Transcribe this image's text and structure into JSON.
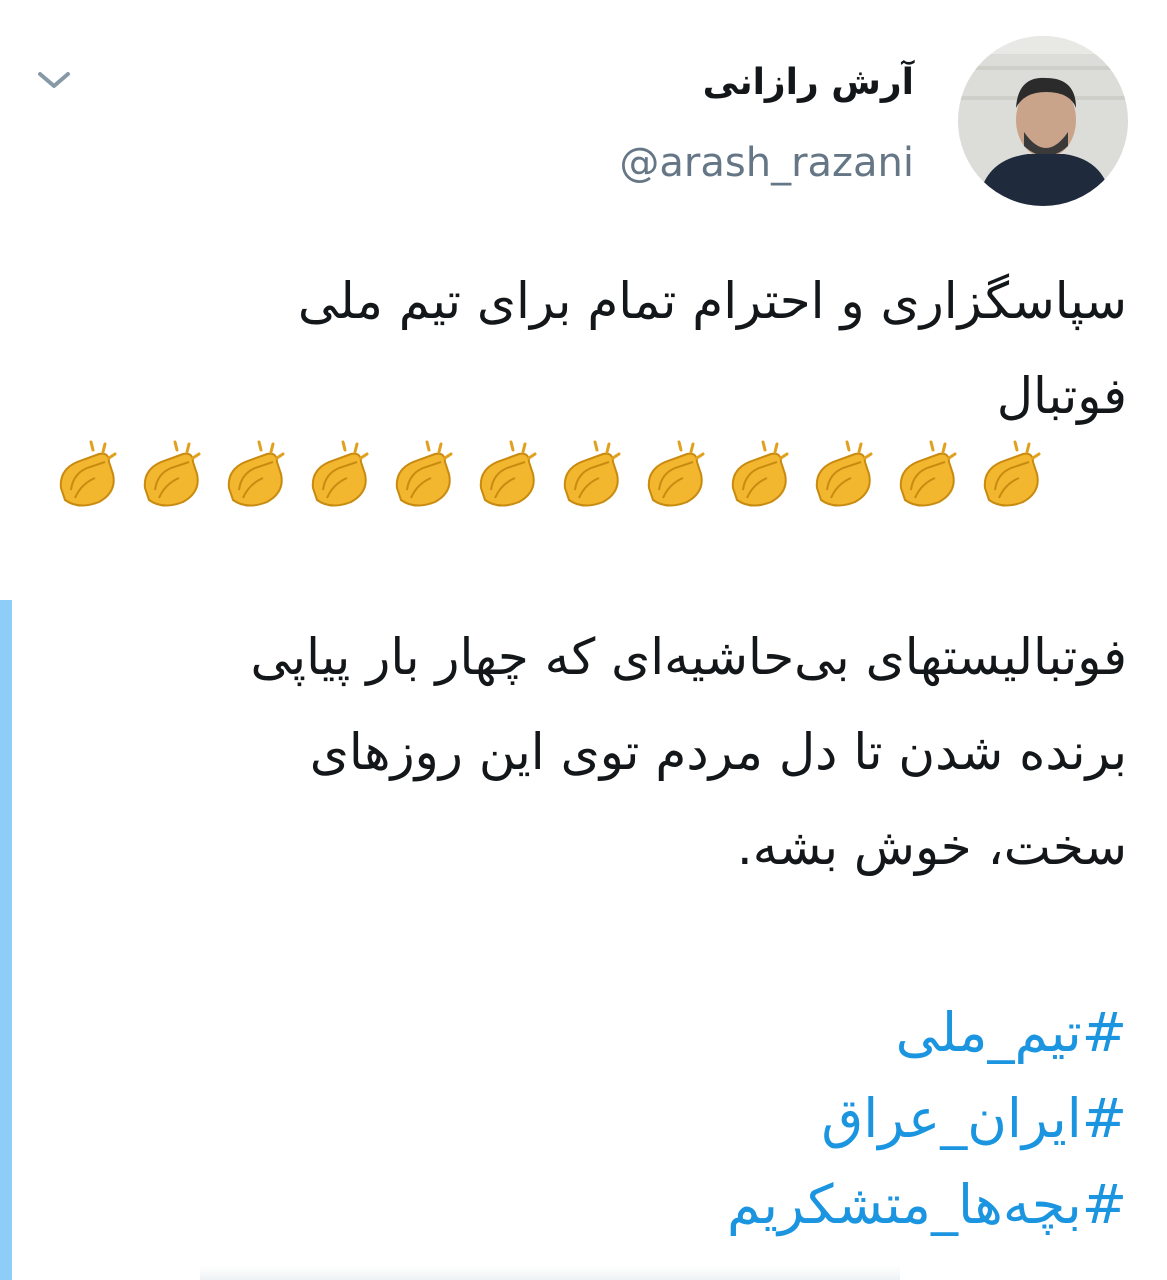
{
  "header": {
    "display_name": "آرش رازانی",
    "handle": "@arash_razani",
    "menu_icon": "chevron-down-icon",
    "avatar_icon": "profile-photo"
  },
  "tweet": {
    "paragraph1": "سپاسگزاری و احترام تمام برای تیم ملی فوتبال",
    "claps": [
      "👏",
      "👏",
      "👏",
      "👏",
      "👏",
      "👏",
      "👏",
      "👏",
      "👏",
      "👏",
      "👏",
      "👏"
    ],
    "paragraph2": "فوتبالیستهای بی‌حاشیه‌ای که چهار بار پیاپی برنده شدن تا دل مردم توی این روزهای سخت، خوش بشه.",
    "hashtags": [
      "#تیم_ملی",
      "#ایران_عراق",
      "#بچه‌ها_متشکریم"
    ]
  },
  "colors": {
    "hashtag": "#1b95e0",
    "handle": "#657786",
    "thread_line": "#8ecdf7"
  }
}
